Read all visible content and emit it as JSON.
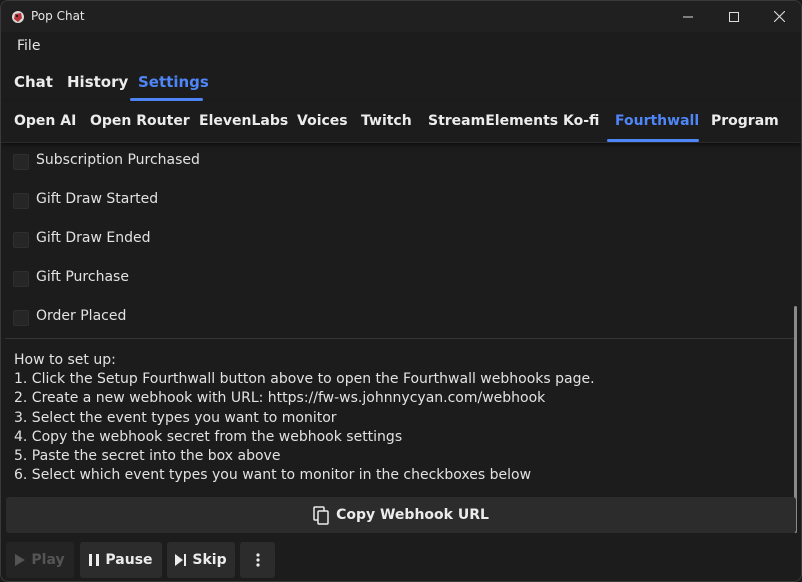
{
  "window": {
    "title": "Pop Chat",
    "icons": {
      "app": "parrot-icon",
      "minimize": "minimize-icon",
      "maximize": "maximize-icon",
      "close": "close-icon"
    }
  },
  "menu": {
    "file": "File"
  },
  "main_tabs": [
    {
      "label": "Chat"
    },
    {
      "label": "History"
    },
    {
      "label": "Settings",
      "active": true
    }
  ],
  "sub_tabs": [
    {
      "label": "Open AI"
    },
    {
      "label": "Open Router"
    },
    {
      "label": "ElevenLabs"
    },
    {
      "label": "Voices"
    },
    {
      "label": "Twitch"
    },
    {
      "label": "StreamElements"
    },
    {
      "label": "Ko-fi"
    },
    {
      "label": "Fourthwall",
      "active": true
    },
    {
      "label": "Program"
    }
  ],
  "events": [
    {
      "label": "Subscription Purchased",
      "checked": false
    },
    {
      "label": "Gift Draw Started",
      "checked": false
    },
    {
      "label": "Gift Draw Ended",
      "checked": false
    },
    {
      "label": "Gift Purchase",
      "checked": false
    },
    {
      "label": "Order Placed",
      "checked": false
    }
  ],
  "instructions": [
    "How to set up:",
    "1. Click the Setup Fourthwall button above to open the Fourthwall webhooks page.",
    "2. Create a new webhook with URL: https://fw-ws.johnnycyan.com/webhook",
    "3. Select the event types you want to monitor",
    "4. Copy the webhook secret from the webhook settings",
    "5. Paste the secret into the box above",
    "6. Select which event types you want to monitor in the checkboxes below"
  ],
  "copy_button": {
    "label": "Copy Webhook URL",
    "icon": "copy-icon"
  },
  "controls": {
    "play": {
      "label": "Play",
      "icon": "play-icon",
      "enabled": false
    },
    "pause": {
      "label": "Pause",
      "icon": "pause-icon"
    },
    "skip": {
      "label": "Skip",
      "icon": "skip-next-icon"
    },
    "more": {
      "icon": "more-vertical-icon"
    }
  },
  "colors": {
    "accent": "#4f86f7",
    "background": "#1c1c1c",
    "button": "#2c2c2c",
    "text": "#e2e2e2"
  }
}
